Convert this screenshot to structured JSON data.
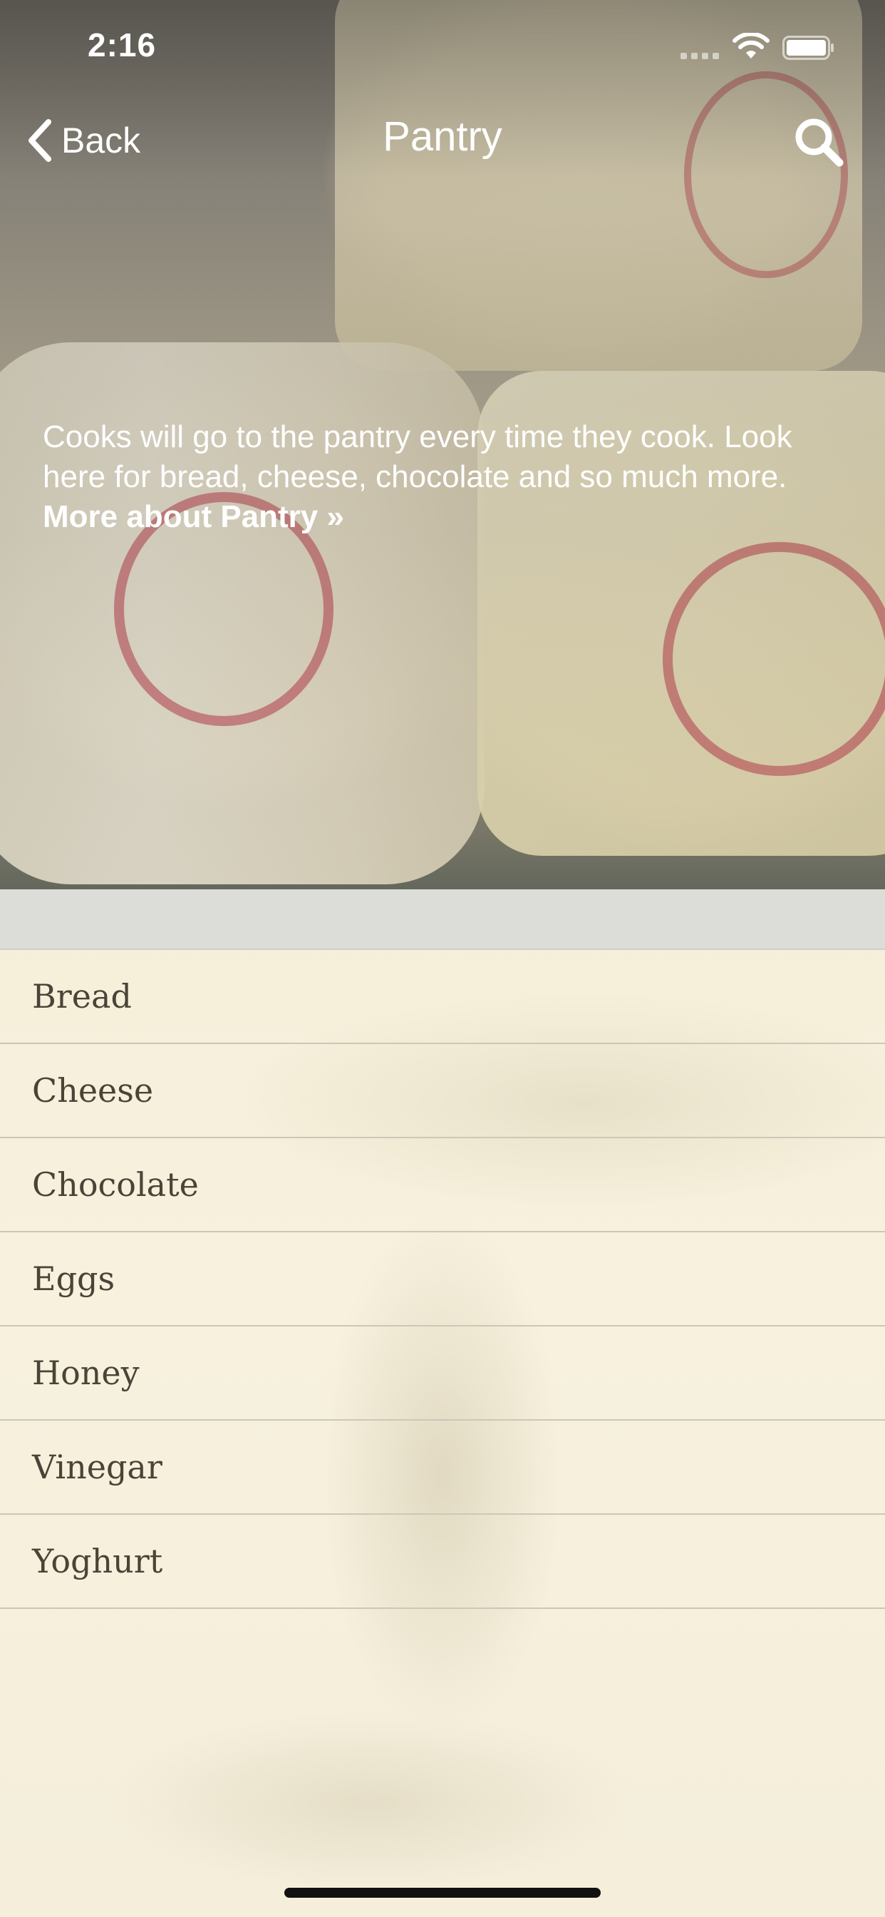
{
  "status_bar": {
    "time": "2:16"
  },
  "nav": {
    "back_label": "Back",
    "title": "Pantry",
    "back_icon": "chevron-left-icon",
    "search_icon": "search-icon"
  },
  "hero": {
    "description": "Cooks will go to the pantry every time they cook. Look here for bread, cheese, chocolate and so much more.",
    "more_link": "More about Pantry »"
  },
  "list": {
    "items": [
      {
        "label": "Bread"
      },
      {
        "label": "Cheese"
      },
      {
        "label": "Chocolate"
      },
      {
        "label": "Eggs"
      },
      {
        "label": "Honey"
      },
      {
        "label": "Vinegar"
      },
      {
        "label": "Yoghurt"
      }
    ]
  },
  "colors": {
    "list_background": "#f7f1de",
    "list_text": "#4a4438",
    "section_header": "#dcdcd8",
    "separator": "#cbc8b8"
  }
}
